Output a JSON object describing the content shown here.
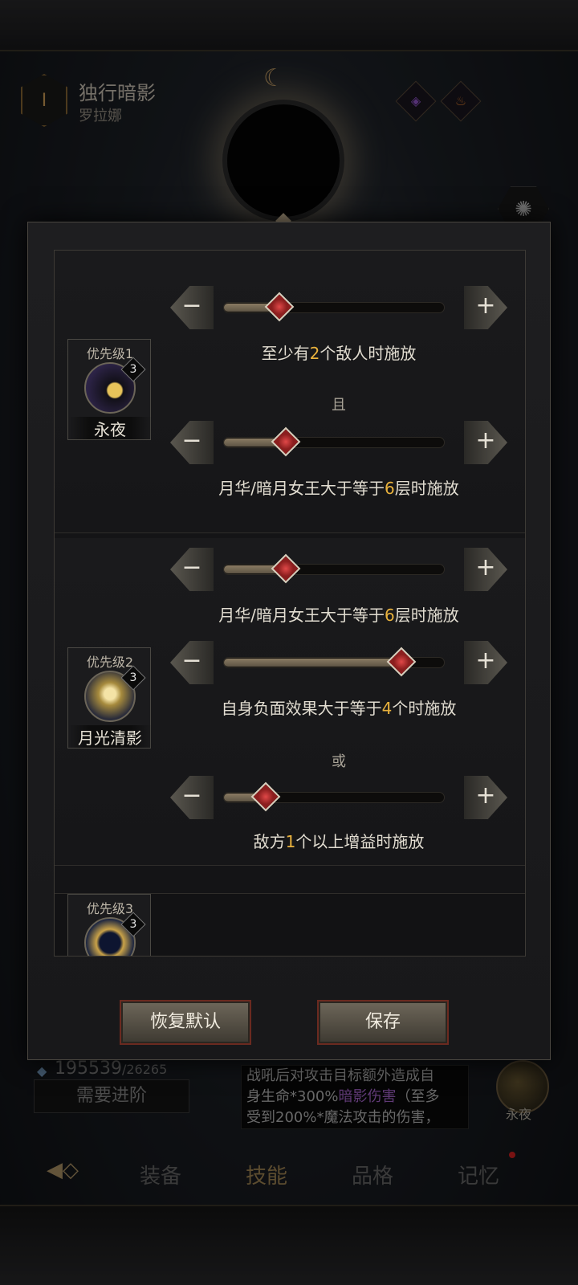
{
  "hero": {
    "rank": "I",
    "title": "独行暗影",
    "name": "罗拉娜"
  },
  "modal": {
    "sections": [
      {
        "priority": "优先级1",
        "skill_name": "永夜",
        "skill_level": "3",
        "conditions": [
          {
            "pre": "至少有",
            "num": "2",
            "post": "个敌人时施放",
            "level": 0.25
          },
          {
            "pre": "月华/暗月女王大于等于",
            "num": "6",
            "post": "层时施放",
            "level": 0.28
          }
        ],
        "logic": "且"
      },
      {
        "priority": "优先级2",
        "skill_name": "月光清影",
        "skill_level": "3",
        "conditions": [
          {
            "pre": "月华/暗月女王大于等于",
            "num": "6",
            "post": "层时施放",
            "level": 0.28
          },
          {
            "pre": "自身负面效果大于等于",
            "num": "4",
            "post": "个时施放",
            "level": 0.8
          },
          {
            "pre": "敌方",
            "num": "1",
            "post": "个以上增益时施放",
            "level": 0.19
          }
        ],
        "logic": "或"
      },
      {
        "priority": "优先级3",
        "skill_level": "3"
      }
    ],
    "buttons": {
      "reset": "恢复默认",
      "save": "保存"
    }
  },
  "background": {
    "exp_current": "195539",
    "exp_max": "/26265",
    "advance_label": "需要进阶",
    "desc_line1": "战吼后对攻击目标额外造成自",
    "desc_line2a": "身生命*300%",
    "desc_line2b": "暗影伤害",
    "desc_line2c": "（至多",
    "desc_line3": "受到200%*魔法攻击的伤害，",
    "side_skill_label": "永夜",
    "nav": [
      "装备",
      "技能",
      "品格",
      "记忆"
    ],
    "nav_active": "技能"
  },
  "icons": {
    "minus": "−",
    "plus": "+"
  }
}
